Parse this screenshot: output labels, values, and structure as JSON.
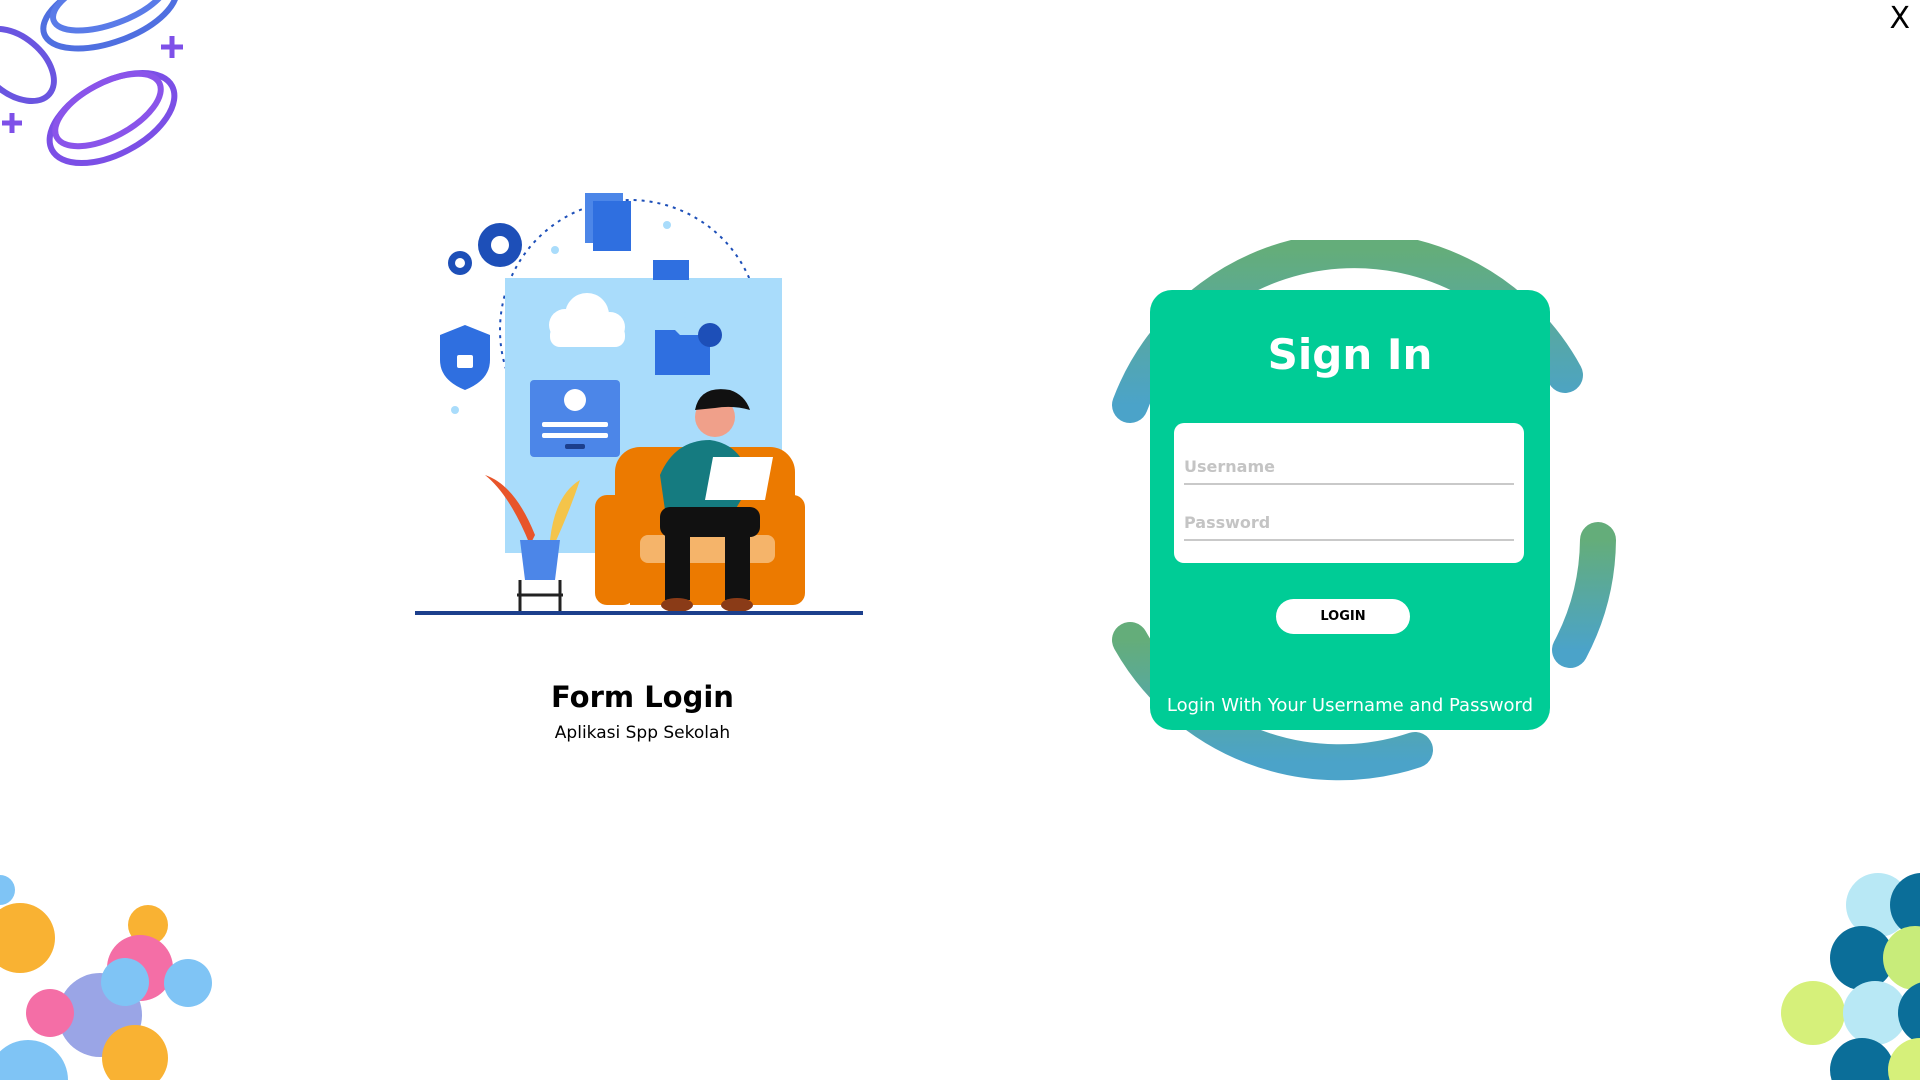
{
  "window": {
    "close_label": "X"
  },
  "branding": {
    "title": "Form Login",
    "subtitle": "Aplikasi Spp Sekolah"
  },
  "login": {
    "title": "Sign In",
    "username_placeholder": "Username",
    "password_placeholder": "Password",
    "button_label": "LOGIN",
    "footer": "Login With Your Username and Password"
  },
  "colors": {
    "card": "#00cc96",
    "ring_top": "#64ad7a",
    "ring_bottom": "#4ba3c9"
  }
}
